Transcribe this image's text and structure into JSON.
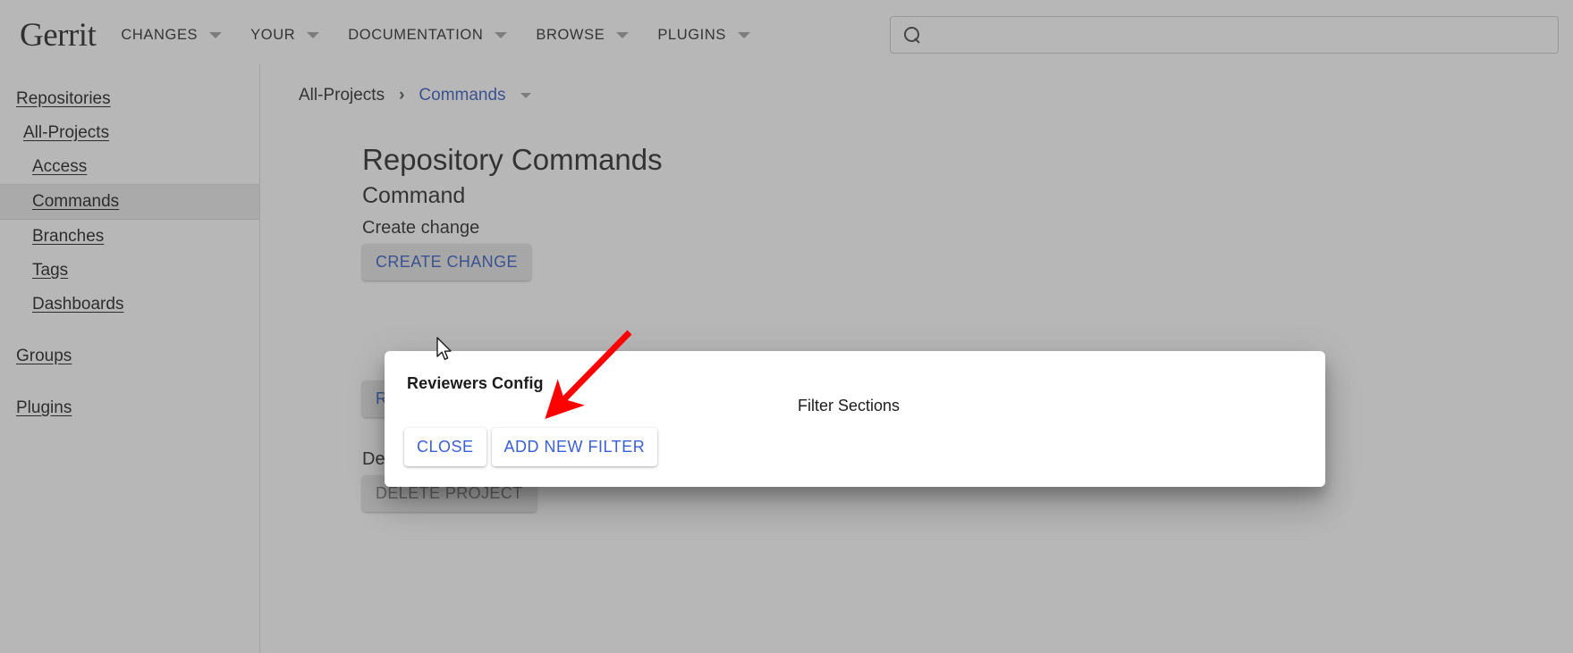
{
  "header": {
    "logo": "Gerrit",
    "nav": [
      {
        "label": "CHANGES",
        "icon": "chevron-down-icon"
      },
      {
        "label": "YOUR",
        "icon": "chevron-down-icon"
      },
      {
        "label": "DOCUMENTATION",
        "icon": "chevron-down-icon"
      },
      {
        "label": "BROWSE",
        "icon": "chevron-down-icon"
      },
      {
        "label": "PLUGINS",
        "icon": "chevron-down-icon"
      }
    ],
    "search": {
      "icon": "search-icon",
      "value": "",
      "placeholder": ""
    }
  },
  "sidebar": {
    "items": [
      {
        "label": "Repositories",
        "level": 0,
        "active": false
      },
      {
        "label": "All-Projects",
        "level": 1,
        "active": false
      },
      {
        "label": "Access",
        "level": 2,
        "active": false
      },
      {
        "label": "Commands",
        "level": 2,
        "active": true
      },
      {
        "label": "Branches",
        "level": 2,
        "active": false
      },
      {
        "label": "Tags",
        "level": 2,
        "active": false
      },
      {
        "label": "Dashboards",
        "level": 2,
        "active": false
      },
      {
        "label": "Groups",
        "level": 0,
        "active": false
      },
      {
        "label": "Plugins",
        "level": 0,
        "active": false
      }
    ]
  },
  "breadcrumb": {
    "root": "All-Projects",
    "separator": "›",
    "current": "Commands",
    "caret_icon": "chevron-down-icon"
  },
  "main": {
    "page_title": "Repository Commands",
    "section_title": "Command",
    "commands": [
      {
        "label": "Create change",
        "button": "CREATE CHANGE",
        "disabled": false
      },
      {
        "label": "",
        "button": "RUN GC",
        "disabled": false
      },
      {
        "label": "Delete Project",
        "button": "DELETE PROJECT",
        "disabled": true
      }
    ]
  },
  "dialog": {
    "title": "Reviewers Config",
    "filter_sections_label": "Filter Sections",
    "buttons": [
      {
        "label": "CLOSE",
        "name": "close-button"
      },
      {
        "label": "ADD NEW FILTER",
        "name": "add-new-filter-button"
      }
    ]
  },
  "annotations": {
    "arrow_color": "#ff0000",
    "cursor_icon": "mouse-pointer-icon"
  },
  "colors": {
    "link_blue": "#2a52be",
    "dialog_button_blue": "#3b5fd6",
    "backdrop": "#545454",
    "page_bg": "#ffffff",
    "button_bg": "#e4e4e4"
  }
}
